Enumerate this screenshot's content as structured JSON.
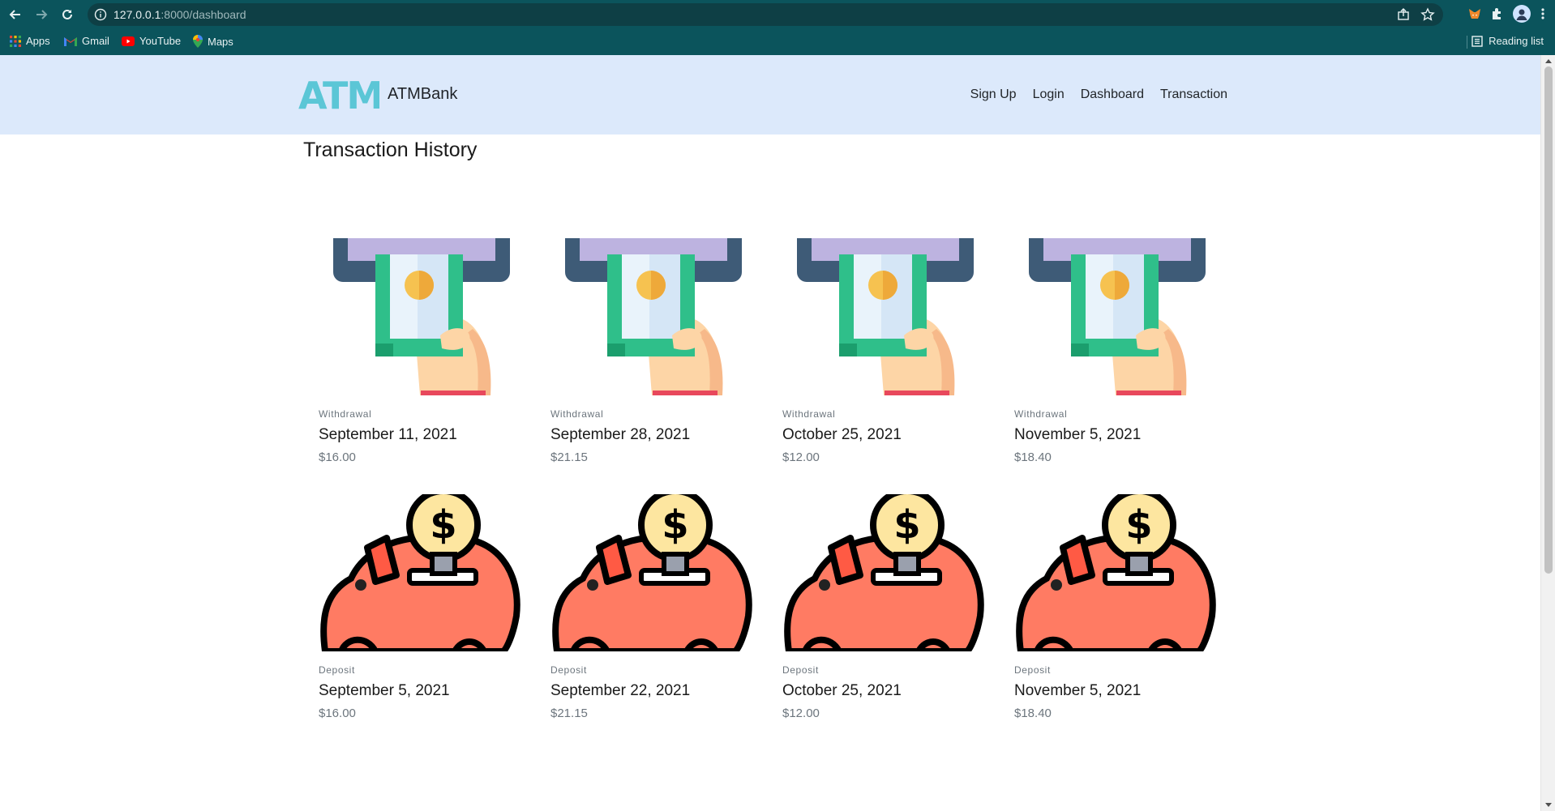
{
  "browser": {
    "url_host": "127.0.0.1",
    "url_rest": ":8000/dashboard",
    "bookmarks": [
      {
        "label": "Apps",
        "icon": "apps-grid-icon"
      },
      {
        "label": "Gmail",
        "icon": "gmail-icon"
      },
      {
        "label": "YouTube",
        "icon": "youtube-icon"
      },
      {
        "label": "Maps",
        "icon": "maps-icon"
      }
    ],
    "reading_list": "Reading list"
  },
  "site": {
    "logo_text": "ATM",
    "brand": "ATMBank",
    "nav": [
      "Sign Up",
      "Login",
      "Dashboard",
      "Transaction"
    ]
  },
  "main": {
    "title": "Transaction History",
    "transactions": [
      {
        "type": "Withdrawal",
        "date": "September 11, 2021",
        "amount": "$16.00",
        "icon": "atm-cash-withdrawal-icon"
      },
      {
        "type": "Withdrawal",
        "date": "September 28, 2021",
        "amount": "$21.15",
        "icon": "atm-cash-withdrawal-icon"
      },
      {
        "type": "Withdrawal",
        "date": "October 25, 2021",
        "amount": "$12.00",
        "icon": "atm-cash-withdrawal-icon"
      },
      {
        "type": "Withdrawal",
        "date": "November 5, 2021",
        "amount": "$18.40",
        "icon": "atm-cash-withdrawal-icon"
      },
      {
        "type": "Deposit",
        "date": "September 5, 2021",
        "amount": "$16.00",
        "icon": "piggy-bank-deposit-icon"
      },
      {
        "type": "Deposit",
        "date": "September 22, 2021",
        "amount": "$21.15",
        "icon": "piggy-bank-deposit-icon"
      },
      {
        "type": "Deposit",
        "date": "October 25, 2021",
        "amount": "$12.00",
        "icon": "piggy-bank-deposit-icon"
      },
      {
        "type": "Deposit",
        "date": "November 5, 2021",
        "amount": "$18.40",
        "icon": "piggy-bank-deposit-icon"
      }
    ]
  },
  "colors": {
    "chrome_bg": "#0b545c",
    "site_nav_bg": "#dce9fb",
    "logo": "#5bc6d6",
    "piggy": "#ff7b63",
    "bulb": "#fde6a0",
    "cash_green": "#2fbf8a",
    "atm_frame": "#3e5b77"
  }
}
